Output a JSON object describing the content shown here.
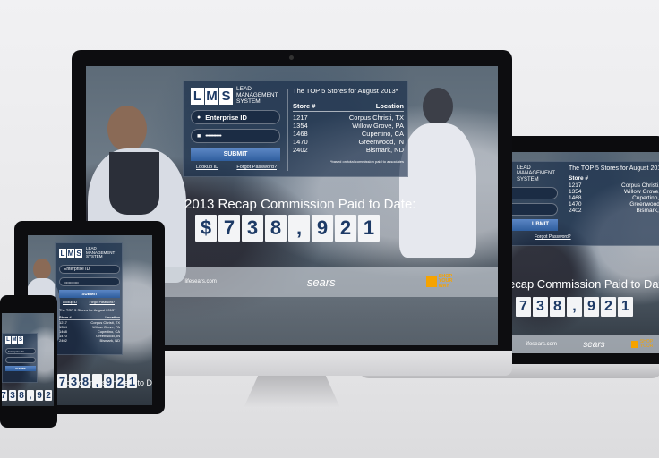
{
  "brand": {
    "letters": [
      "L",
      "M",
      "S"
    ],
    "line1": "LEAD",
    "line2": "MANAGEMENT",
    "line3": "SYSTEM"
  },
  "login": {
    "enterprise_placeholder": "Enterprise ID",
    "password_mask": "••••••••••••",
    "submit_label": "SUBMIT",
    "lookup_link": "Lookup ID",
    "forgot_link": "Forgot Password?"
  },
  "top5": {
    "heading": "The TOP 5 Stores for August 2013*",
    "col_store": "Store #",
    "col_location": "Location",
    "rows": [
      {
        "store": "1217",
        "location": "Corpus Christi, TX"
      },
      {
        "store": "1354",
        "location": "Willow Grove, PA"
      },
      {
        "store": "1468",
        "location": "Cupertino, CA"
      },
      {
        "store": "1470",
        "location": "Greenwood, IN"
      },
      {
        "store": "2402",
        "location": "Bismark, ND"
      }
    ],
    "footnote": "*based on total commission paid to associates"
  },
  "recap": {
    "label": "2013 Recap Commission Paid to Date:",
    "label_short": "ecap Commission Paid to Date:",
    "label_laptop": "ecap Commission Paid to Date",
    "digits": [
      "$",
      "7",
      "3",
      "8",
      ",",
      "9",
      "2",
      "1"
    ],
    "digits_laptop": [
      "7",
      "3",
      "8",
      ",",
      "9",
      "2",
      "1"
    ],
    "digits_phone": [
      "7",
      "3",
      "8",
      ",",
      "9",
      "2",
      "1"
    ]
  },
  "footer": {
    "site": "lifesears.com",
    "sears": "sears",
    "shop1": "SHOP",
    "shop2": "YOUR",
    "shop3": "WAY"
  },
  "colors": {
    "accent": "#1d3a66",
    "submit": "#3f6eb0",
    "shop": "#f6a300"
  }
}
